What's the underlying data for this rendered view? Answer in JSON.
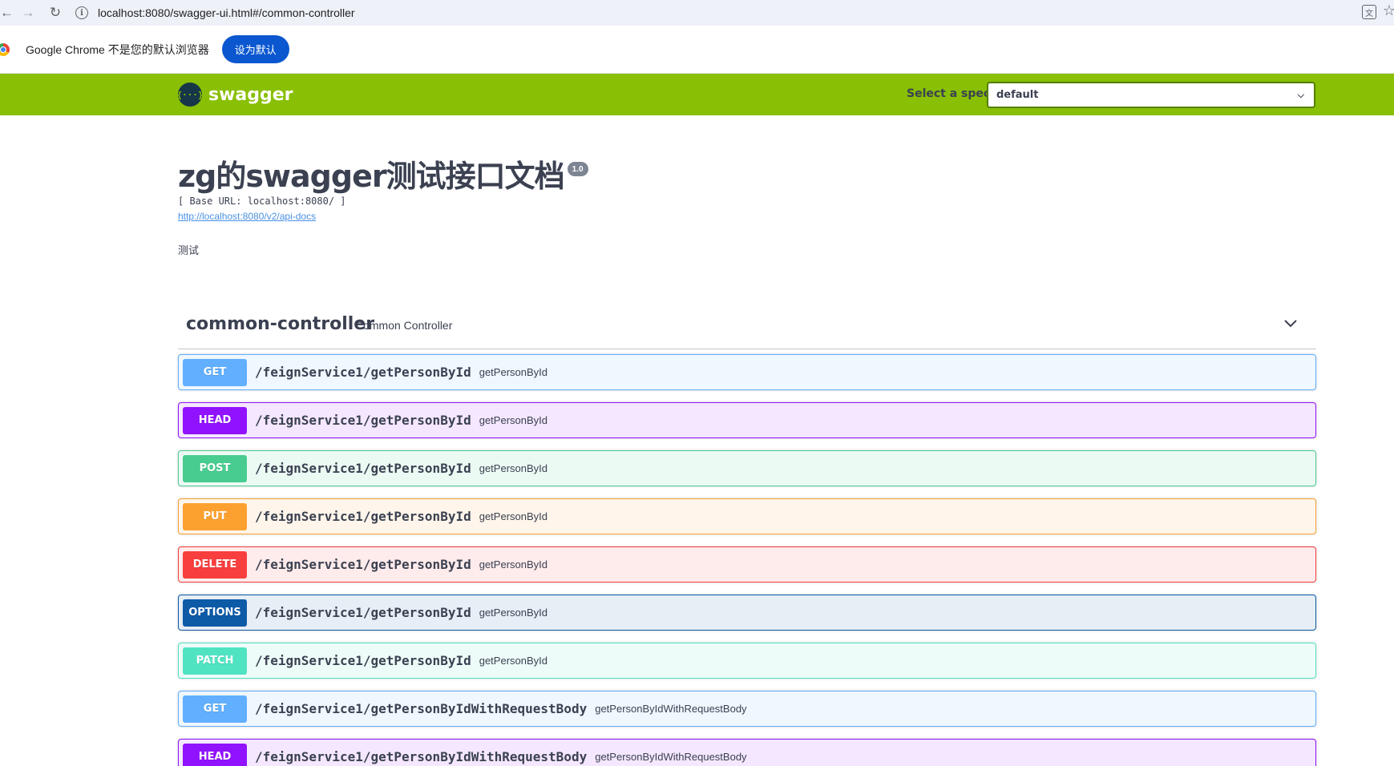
{
  "browser": {
    "url": "localhost:8080/swagger-ui.html#/common-controller",
    "infobar_text": "Google Chrome 不是您的默认浏览器",
    "set_default_label": "设为默认"
  },
  "topbar": {
    "logo_text": "swagger",
    "select_label": "Select a spec",
    "selected_spec": "default",
    "brand_color": "#89bf04"
  },
  "info": {
    "title": "zg的swagger测试接口文档",
    "version": "1.0",
    "base_url": "[ Base URL: localhost:8080/ ]",
    "api_docs_link": "http://localhost:8080/v2/api-docs",
    "description": "测试"
  },
  "tag": {
    "name": "common-controller",
    "description": "Common Controller"
  },
  "operations": [
    {
      "method": "GET",
      "path": "/feignService1/getPersonById",
      "summary": "getPersonById",
      "color": "#61affe"
    },
    {
      "method": "HEAD",
      "path": "/feignService1/getPersonById",
      "summary": "getPersonById",
      "color": "#9012fe"
    },
    {
      "method": "POST",
      "path": "/feignService1/getPersonById",
      "summary": "getPersonById",
      "color": "#49cc90"
    },
    {
      "method": "PUT",
      "path": "/feignService1/getPersonById",
      "summary": "getPersonById",
      "color": "#fca130"
    },
    {
      "method": "DELETE",
      "path": "/feignService1/getPersonById",
      "summary": "getPersonById",
      "color": "#f93e3e"
    },
    {
      "method": "OPTIONS",
      "path": "/feignService1/getPersonById",
      "summary": "getPersonById",
      "color": "#0d5aa7"
    },
    {
      "method": "PATCH",
      "path": "/feignService1/getPersonById",
      "summary": "getPersonById",
      "color": "#50e3c2"
    },
    {
      "method": "GET",
      "path": "/feignService1/getPersonByIdWithRequestBody",
      "summary": "getPersonByIdWithRequestBody",
      "color": "#61affe"
    },
    {
      "method": "HEAD",
      "path": "/feignService1/getPersonByIdWithRequestBody",
      "summary": "getPersonByIdWithRequestBody",
      "color": "#9012fe"
    }
  ]
}
